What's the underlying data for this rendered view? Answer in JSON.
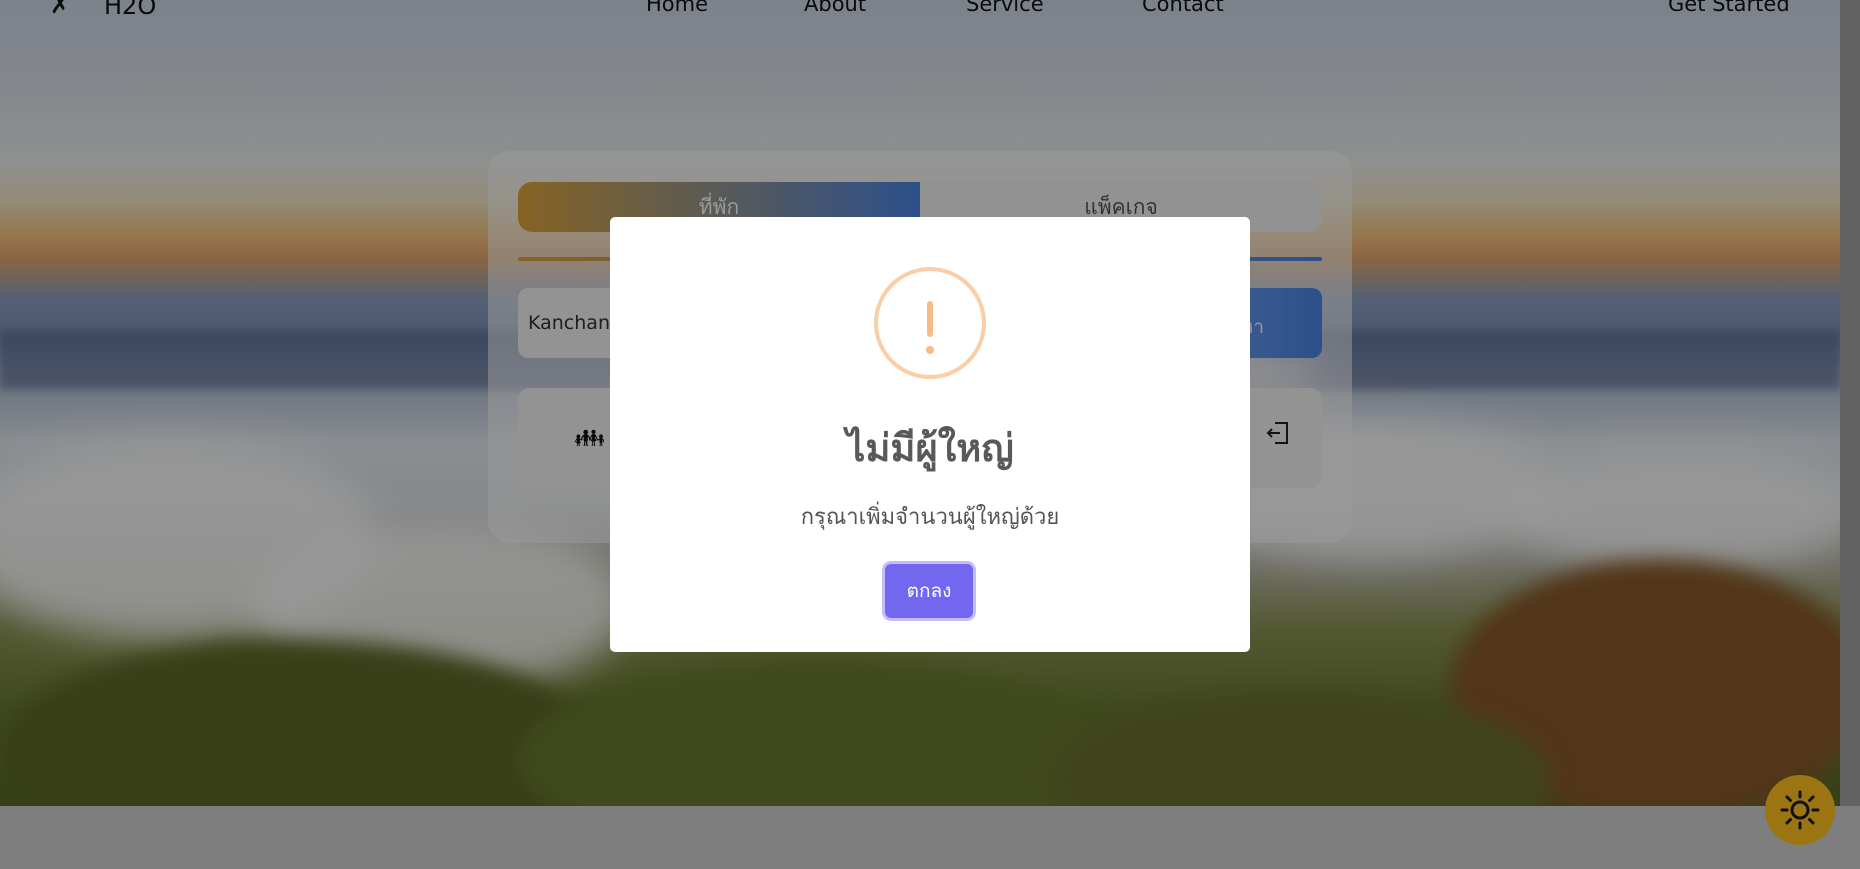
{
  "nav": {
    "brand": "H2O",
    "links": [
      "Home",
      "About",
      "Service",
      "Contact"
    ],
    "cta": "Get Started"
  },
  "search": {
    "tabs": [
      "ที่พัก",
      "แพ็คเกจ"
    ],
    "destination_value": "Kanchana",
    "search_button_label": "หา"
  },
  "dialog": {
    "title": "ไม่มีผู้ใหญ่",
    "text": "กรุณาเพิ่มจำนวนผู้ใหญ่ด้วย",
    "confirm_label": "ตกลง",
    "icon": "warning-icon"
  },
  "colors": {
    "confirm_button": "#7367f0",
    "warning_icon": "#f8bb86",
    "theme_toggle": "#9a7512"
  }
}
